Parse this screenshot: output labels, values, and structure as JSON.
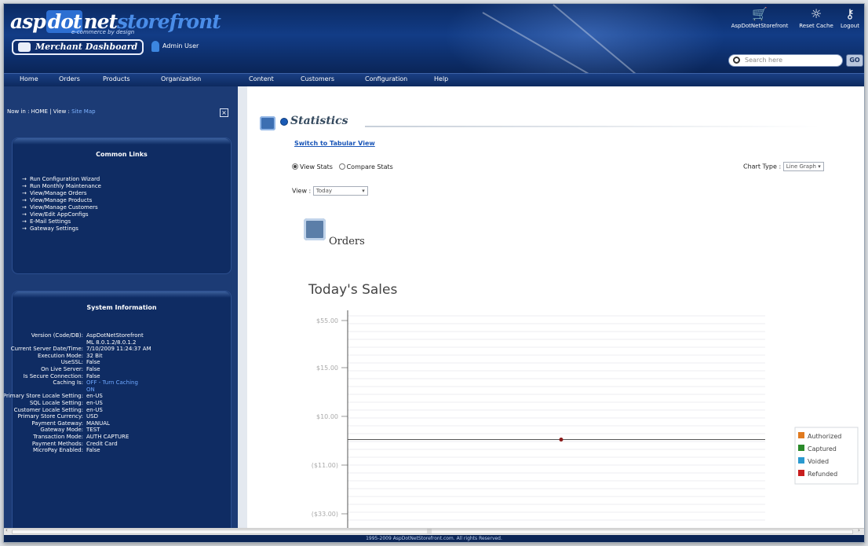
{
  "header": {
    "logo": {
      "part1": "asp",
      "part2": "dot",
      "part3": "net",
      "part4": "storefront"
    },
    "tagline": "e-commerce by design",
    "dashboard_button": "Merchant Dashboard",
    "admin_user": "Admin User",
    "icons": [
      {
        "icon": "shopping-cart-icon",
        "label": "AspDotNetStorefront"
      },
      {
        "icon": "refresh-icon",
        "label": "Reset Cache"
      },
      {
        "icon": "key-icon",
        "label": "Logout"
      }
    ],
    "search_placeholder": "Search here",
    "go_label": "GO"
  },
  "nav": {
    "items": [
      "Home",
      "Orders",
      "Products",
      "Organization",
      "Content",
      "Customers",
      "Configuration",
      "Help"
    ]
  },
  "sidebar": {
    "breadcrumb_prefix": "Now in : HOME | View : ",
    "breadcrumb_link": "Site Map",
    "collapse_glyph": "×",
    "common_links": {
      "title": "Common Links",
      "items": [
        "Run Configuration Wizard",
        "Run Monthly Maintenance",
        "View/Manage Orders",
        "View/Manage Products",
        "View/Manage Customers",
        "View/Edit AppConfigs",
        "E-Mail Settings",
        "Gateway Settings"
      ]
    },
    "system_info": {
      "title": "System Information",
      "rows": [
        {
          "k": "Version (Code/DB):",
          "v": "AspDotNetStorefront"
        },
        {
          "k": "",
          "v": "ML 8.0.1.2/8.0.1.2"
        },
        {
          "k": "Current Server Date/Time:",
          "v": "7/10/2009 11:24:37 AM"
        },
        {
          "k": "Execution Mode:",
          "v": "32 Bit"
        },
        {
          "k": "UseSSL:",
          "v": "False"
        },
        {
          "k": "On Live Server:",
          "v": "False"
        },
        {
          "k": "Is Secure Connection:",
          "v": "False"
        },
        {
          "k": "Caching Is:",
          "v": "OFF - Turn Caching"
        },
        {
          "k": "",
          "v": "ON"
        },
        {
          "k": "Primary Store Locale Setting:",
          "v": "en-US"
        },
        {
          "k": "SQL Locale Setting:",
          "v": "en-US"
        },
        {
          "k": "Customer Locale Setting:",
          "v": "en-US"
        },
        {
          "k": "Primary Store Currency:",
          "v": "USD"
        },
        {
          "k": "Payment Gateway:",
          "v": "MANUAL"
        },
        {
          "k": "Gateway Mode:",
          "v": "TEST"
        },
        {
          "k": "Transaction Mode:",
          "v": "AUTH CAPTURE"
        },
        {
          "k": "Payment Methods:",
          "v": "Credit Card"
        },
        {
          "k": "MicroPay Enabled:",
          "v": "False"
        }
      ]
    }
  },
  "main": {
    "section_title": "Statistics",
    "switch_link": "Switch to Tabular View",
    "radio_view_stats": "View Stats",
    "radio_compare_stats": "Compare Stats",
    "chart_type_label": "Chart Type :",
    "chart_type_value": "Line Graph",
    "view_label": "View :",
    "view_value": "Today",
    "orders_title": "Orders"
  },
  "chart_data": {
    "type": "line",
    "title": "Today's Sales",
    "ytick_labels": [
      "$55.00",
      "$15.00",
      "$10.00",
      "($11.00)",
      "($33.00)"
    ],
    "ylim": [
      -33,
      55
    ],
    "series": [
      {
        "name": "Authorized",
        "color": "#e07a1f",
        "values": [
          0
        ]
      },
      {
        "name": "Captured",
        "color": "#2a8a2a",
        "values": [
          0
        ]
      },
      {
        "name": "Voided",
        "color": "#2a9ad0",
        "values": [
          0
        ]
      },
      {
        "name": "Refunded",
        "color": "#c81e1e",
        "values": [
          0
        ]
      }
    ],
    "grid": true,
    "legend_position": "right"
  },
  "footer": {
    "text": "1995-2009 AspDotNetStorefront.com. All rights Reserved."
  },
  "scrollbar": {
    "left": "‹",
    "right": "›",
    "grip": "|||"
  }
}
